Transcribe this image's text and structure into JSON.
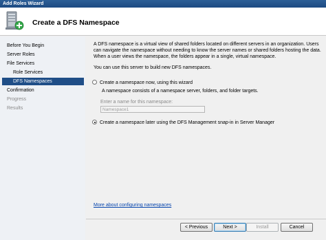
{
  "window": {
    "title": "Add Roles Wizard"
  },
  "header": {
    "title": "Create a DFS Namespace",
    "icon": "server-roles-add-icon"
  },
  "nav": {
    "items": [
      {
        "label": "Before You Begin",
        "state": "normal"
      },
      {
        "label": "Server Roles",
        "state": "normal"
      },
      {
        "label": "File Services",
        "state": "normal"
      },
      {
        "label": "Role Services",
        "state": "normal"
      },
      {
        "label": "DFS Namespaces",
        "state": "selected"
      },
      {
        "label": "Confirmation",
        "state": "normal"
      },
      {
        "label": "Progress",
        "state": "disabled"
      },
      {
        "label": "Results",
        "state": "disabled"
      }
    ]
  },
  "main": {
    "intro": "A DFS namespace is a virtual view of shared folders located on different servers in an organization. Users can navigate the namespace without needing to know the server names or shared folders hosting the data. When a user views the namespace, the folders appear in a single, virtual namespace.",
    "can_use": "You can use this server to build new DFS namespaces.",
    "option_now": {
      "label": "Create a namespace now, using this wizard",
      "checked": false
    },
    "option_now_desc": "A namespace consists of a namespace server, folders, and folder targets.",
    "enter_name_label": "Enter a name for this namespace:",
    "name_input": {
      "value": "Namespace1",
      "enabled": false
    },
    "option_later": {
      "label": "Create a namespace later using the DFS Management snap-in in Server Manager",
      "checked": true
    },
    "more_link": "More about configuring namespaces"
  },
  "buttons": {
    "previous": "< Previous",
    "next": "Next >",
    "install": "Install",
    "cancel": "Cancel"
  },
  "colors": {
    "title_bar": "#1c4a82",
    "nav_selected": "#1f4e87",
    "link": "#0645ad"
  }
}
